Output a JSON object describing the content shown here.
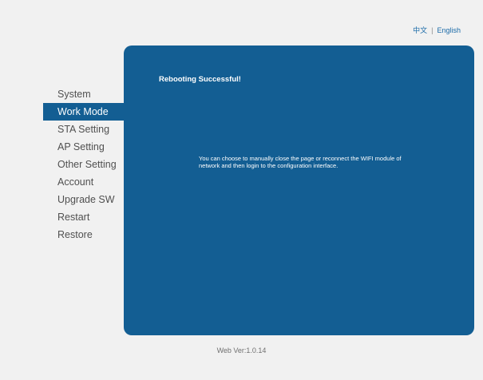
{
  "language": {
    "chinese": "中文",
    "separator": "|",
    "english": "English"
  },
  "sidebar": {
    "items": [
      {
        "label": "System"
      },
      {
        "label": "Work Mode"
      },
      {
        "label": "STA Setting"
      },
      {
        "label": "AP Setting"
      },
      {
        "label": "Other Setting"
      },
      {
        "label": "Account"
      },
      {
        "label": "Upgrade SW"
      },
      {
        "label": "Restart"
      },
      {
        "label": "Restore"
      }
    ]
  },
  "main": {
    "title": "Rebooting Successful!",
    "message": "You can choose to manually close the page or reconnect the WIFI module of network and then login to the configuration interface."
  },
  "footer": {
    "version": "Web Ver:1.0.14"
  },
  "colors": {
    "accent": "#135e93",
    "background": "#f1f1f1",
    "link": "#1a6aa8"
  }
}
